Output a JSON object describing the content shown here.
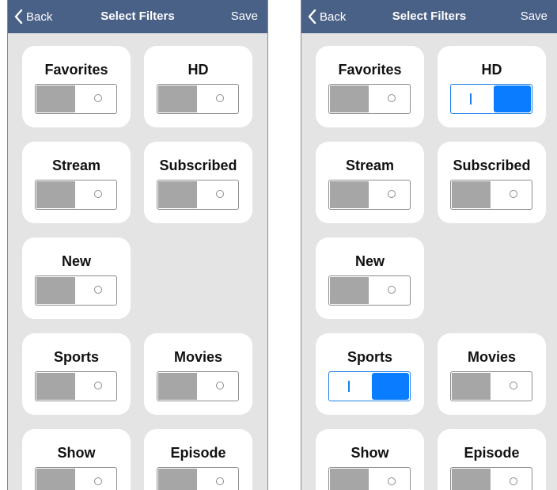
{
  "colors": {
    "navbar": "#4a6187",
    "background": "#e4e4e4",
    "toggle_on": "#0a7cff",
    "toggle_off_knob": "#a6a6a6"
  },
  "screens": [
    {
      "navbar": {
        "back_label": "Back",
        "title": "Select Filters",
        "save_label": "Save"
      },
      "filters": [
        {
          "label": "Favorites",
          "on": false
        },
        {
          "label": "HD",
          "on": false
        },
        {
          "label": "Stream",
          "on": false
        },
        {
          "label": "Subscribed",
          "on": false
        },
        {
          "label": "New",
          "on": false
        },
        {
          "label": "Sports",
          "on": false
        },
        {
          "label": "Movies",
          "on": false
        },
        {
          "label": "Show",
          "on": false
        },
        {
          "label": "Episode",
          "on": false
        }
      ]
    },
    {
      "navbar": {
        "back_label": "Back",
        "title": "Select Filters",
        "save_label": "Save"
      },
      "filters": [
        {
          "label": "Favorites",
          "on": false
        },
        {
          "label": "HD",
          "on": true
        },
        {
          "label": "Stream",
          "on": false
        },
        {
          "label": "Subscribed",
          "on": false
        },
        {
          "label": "New",
          "on": false
        },
        {
          "label": "Sports",
          "on": true
        },
        {
          "label": "Movies",
          "on": false
        },
        {
          "label": "Show",
          "on": false
        },
        {
          "label": "Episode",
          "on": false
        }
      ]
    }
  ]
}
